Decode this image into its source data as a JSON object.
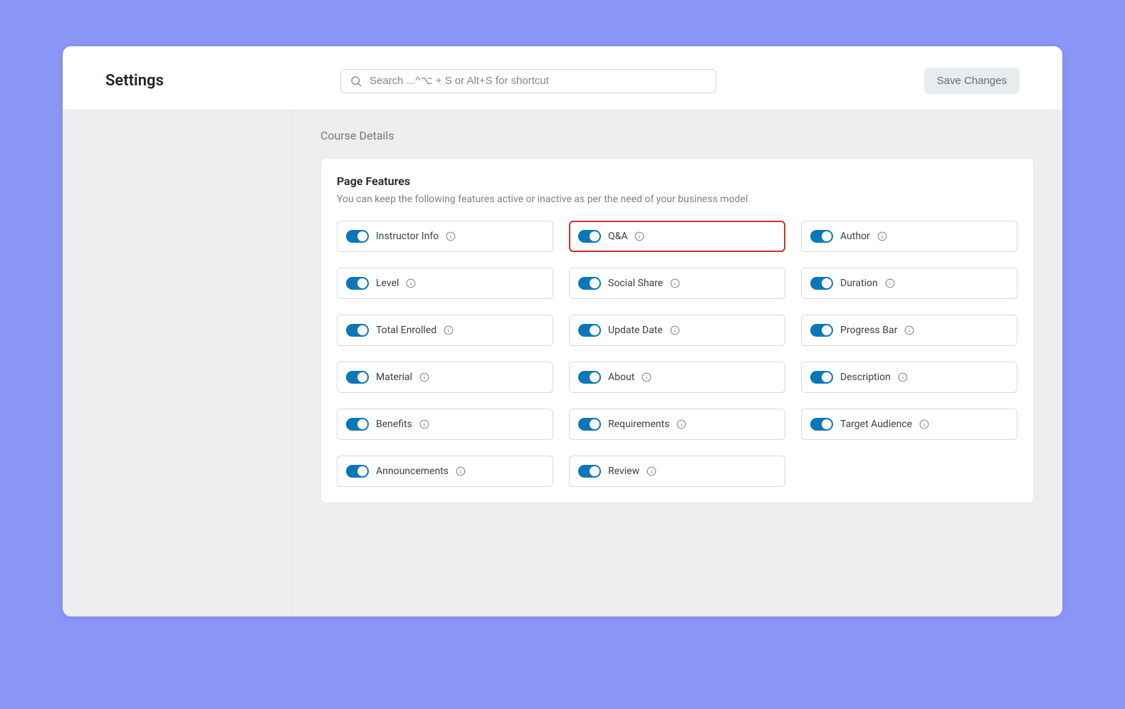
{
  "header": {
    "title": "Settings",
    "search_placeholder": "Search ...^⌥ + S or Alt+S for shortcut",
    "save_label": "Save Changes"
  },
  "breadcrumb": "Course Details",
  "panel": {
    "title": "Page Features",
    "description": "You can keep the following features active or inactive as per the need of your business model"
  },
  "features": [
    {
      "label": "Instructor Info",
      "on": true,
      "highlight": false
    },
    {
      "label": "Q&A",
      "on": true,
      "highlight": true
    },
    {
      "label": "Author",
      "on": true,
      "highlight": false
    },
    {
      "label": "Level",
      "on": true,
      "highlight": false
    },
    {
      "label": "Social Share",
      "on": true,
      "highlight": false
    },
    {
      "label": "Duration",
      "on": true,
      "highlight": false
    },
    {
      "label": "Total Enrolled",
      "on": true,
      "highlight": false
    },
    {
      "label": "Update Date",
      "on": true,
      "highlight": false
    },
    {
      "label": "Progress Bar",
      "on": true,
      "highlight": false
    },
    {
      "label": "Material",
      "on": true,
      "highlight": false
    },
    {
      "label": "About",
      "on": true,
      "highlight": false
    },
    {
      "label": "Description",
      "on": true,
      "highlight": false
    },
    {
      "label": "Benefits",
      "on": true,
      "highlight": false
    },
    {
      "label": "Requirements",
      "on": true,
      "highlight": false
    },
    {
      "label": "Target Audience",
      "on": true,
      "highlight": false
    },
    {
      "label": "Announcements",
      "on": true,
      "highlight": false
    },
    {
      "label": "Review",
      "on": true,
      "highlight": false
    }
  ]
}
